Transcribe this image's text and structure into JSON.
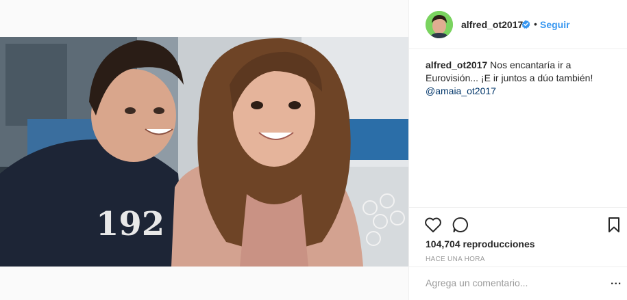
{
  "post": {
    "username": "alfred_ot2017",
    "verified_icon": "verified-badge-icon",
    "separator": "•",
    "follow_label": "Seguir",
    "caption": {
      "user": "alfred_ot2017",
      "text": " Nos encantaría ir a Eurovisión... ¡E ir juntos a dúo también! ",
      "mention": "@amaia_ot2017"
    },
    "actions": {
      "like_icon": "heart-icon",
      "comment_icon": "comment-icon",
      "save_icon": "bookmark-icon"
    },
    "views": {
      "count": "104,704",
      "label": " reproducciones"
    },
    "timestamp": "HACE UNA HORA",
    "comment": {
      "placeholder": "Agrega un comentario...",
      "more_label": "..."
    }
  },
  "colors": {
    "link_blue": "#3897f0",
    "mention_blue": "#003569",
    "muted_gray": "#999999",
    "border": "#efefef",
    "text": "#262626"
  }
}
